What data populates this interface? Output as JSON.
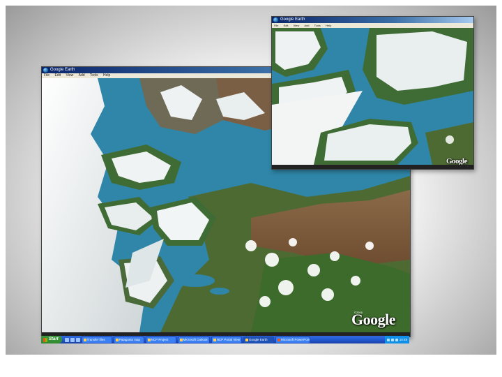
{
  "big_window": {
    "title": "Google Earth",
    "menu": [
      "File",
      "Edit",
      "View",
      "Add",
      "Tools",
      "Help"
    ],
    "logo": "Google",
    "logo_small": "©2006"
  },
  "small_window": {
    "title": "Google Earth",
    "menu": [
      "File",
      "Edit",
      "View",
      "Add",
      "Tools",
      "Help"
    ],
    "logo": "Google"
  },
  "taskbar": {
    "start_label": "Start",
    "tasks": [
      {
        "label": "Transfer files",
        "active": false
      },
      {
        "label": "Patagonia map",
        "active": false
      },
      {
        "label": "NCP Project",
        "active": false
      },
      {
        "label": "Microsoft Outlook",
        "active": false
      },
      {
        "label": "NCP Portal View",
        "active": false
      },
      {
        "label": "Google Earth",
        "active": true
      },
      {
        "label": "Microsoft PowerPoint",
        "active": false
      }
    ],
    "clock": "10:48"
  },
  "colors": {
    "water": "#2f86a8",
    "ice": "#f2f4f4",
    "rock": "#6e6a55",
    "vegetation": "#3d6b2c",
    "steppe": "#7b5a3a"
  }
}
